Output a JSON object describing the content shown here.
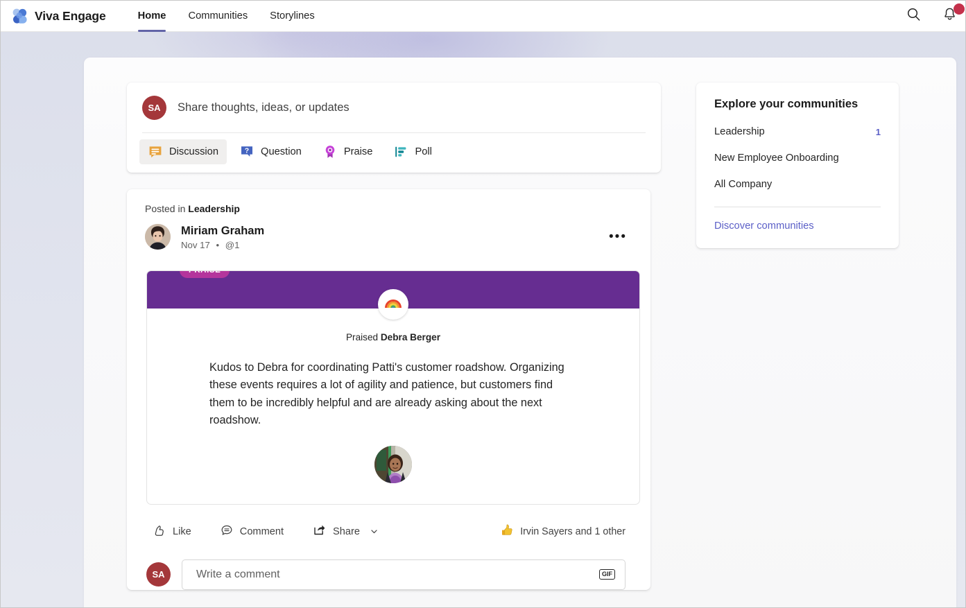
{
  "app": {
    "brand": "Viva Engage",
    "logo_icon": "viva-engage-logo",
    "nav_tabs": [
      {
        "label": "Home",
        "active": true
      },
      {
        "label": "Communities",
        "active": false
      },
      {
        "label": "Storylines",
        "active": false
      }
    ],
    "search_icon": "search-icon",
    "notifications_icon": "bell-icon",
    "notifications_badge": ""
  },
  "composer": {
    "avatar_initials": "SA",
    "avatar_color": "#a4373a",
    "placeholder": "Share thoughts, ideas, or updates",
    "types": [
      {
        "label": "Discussion",
        "icon": "discussion-icon",
        "selected": true
      },
      {
        "label": "Question",
        "icon": "question-icon",
        "selected": false
      },
      {
        "label": "Praise",
        "icon": "praise-icon",
        "selected": false
      },
      {
        "label": "Poll",
        "icon": "poll-icon",
        "selected": false
      }
    ]
  },
  "post": {
    "posted_in_prefix": "Posted in",
    "community": "Leadership",
    "author": "Miriam Graham",
    "date": "Nov 17",
    "separator": "•",
    "mentions": "@1",
    "more_label": "•••",
    "praise": {
      "badge": "PRAISE",
      "band_color": "#662d91",
      "badge_color": "#b4359c",
      "emoji_icon": "rainbow-icon",
      "praised_prefix": "Praised",
      "praised_person": "Debra Berger",
      "body": "Kudos to Debra for coordinating Patti's customer roadshow. Organizing these events requires a lot of agility and patience, but customers find them to be incredibly helpful and are already asking about the next roadshow.",
      "attached_photo": "person-photo"
    },
    "actions": [
      {
        "label": "Like",
        "icon": "thumbs-up-outline-icon"
      },
      {
        "label": "Comment",
        "icon": "comment-icon"
      },
      {
        "label": "Share",
        "icon": "share-icon",
        "chevron": true
      }
    ],
    "share_chevron": "chevron-down-icon",
    "reactions": {
      "icon": "thumbs-up-emoji",
      "text": "Irvin Sayers and 1 other"
    },
    "comment": {
      "avatar_initials": "SA",
      "placeholder": "Write a comment",
      "gif_label": "GIF"
    }
  },
  "rail": {
    "title": "Explore your communities",
    "items": [
      {
        "label": "Leadership",
        "count": "1"
      },
      {
        "label": "New Employee Onboarding",
        "count": ""
      },
      {
        "label": "All Company",
        "count": ""
      }
    ],
    "discover_link": "Discover communities"
  }
}
